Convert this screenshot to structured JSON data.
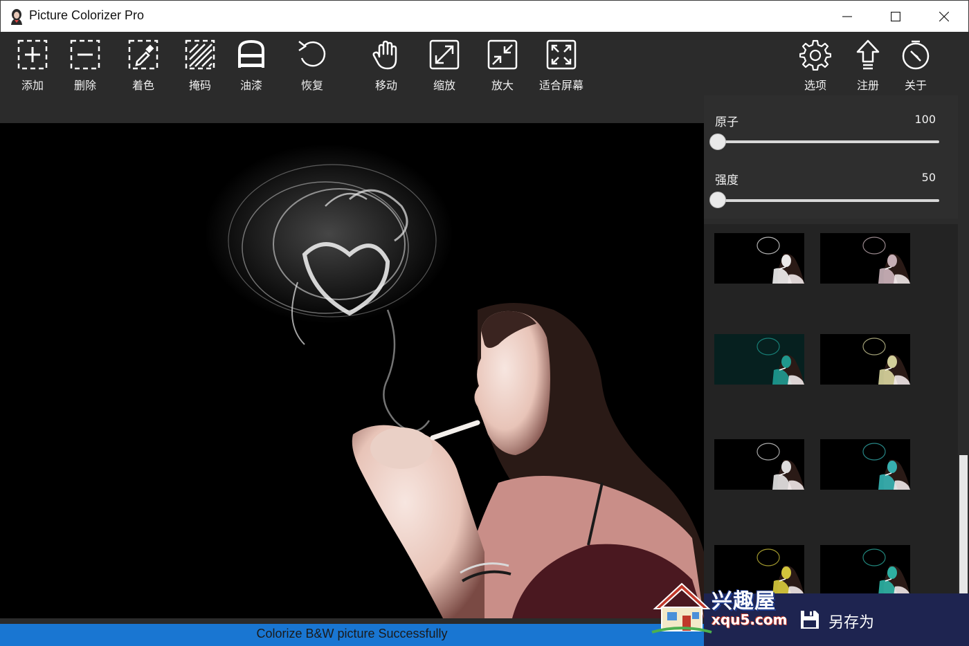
{
  "window": {
    "title": "Picture Colorizer Pro",
    "controls": [
      "minimize",
      "maximize",
      "close"
    ]
  },
  "toolbar": {
    "add": "添加",
    "delete": "删除",
    "colorize": "着色",
    "mask": "掩码",
    "paint": "油漆",
    "restore": "恢复",
    "move": "移动",
    "zoom": "缩放",
    "enlarge": "放大",
    "fit_screen": "适合屏幕",
    "options": "选项",
    "register": "注册",
    "about": "关于"
  },
  "sliders": {
    "atom": {
      "label": "原子",
      "value": "100",
      "position": 0.0
    },
    "intensity": {
      "label": "强度",
      "value": "50",
      "position": 0.0
    }
  },
  "thumbnails": [
    {
      "tint": "#ffffff"
    },
    {
      "tint": "#d8c0c8"
    },
    {
      "tint": "#1fa59a"
    },
    {
      "tint": "#e6e3a8"
    },
    {
      "tint": "#f2f2f2"
    },
    {
      "tint": "#38c0c0"
    },
    {
      "tint": "#e6d840"
    },
    {
      "tint": "#2fbfb0"
    }
  ],
  "status": {
    "text": "Colorize B&W picture Successfully"
  },
  "save": {
    "label": "另存为"
  },
  "watermark": {
    "cn": "兴趣屋",
    "en": "xqu5.com"
  },
  "colors": {
    "toolbar_bg": "#2b2b2b",
    "status_blue": "#1976d2",
    "save_bg": "#1e2450"
  }
}
